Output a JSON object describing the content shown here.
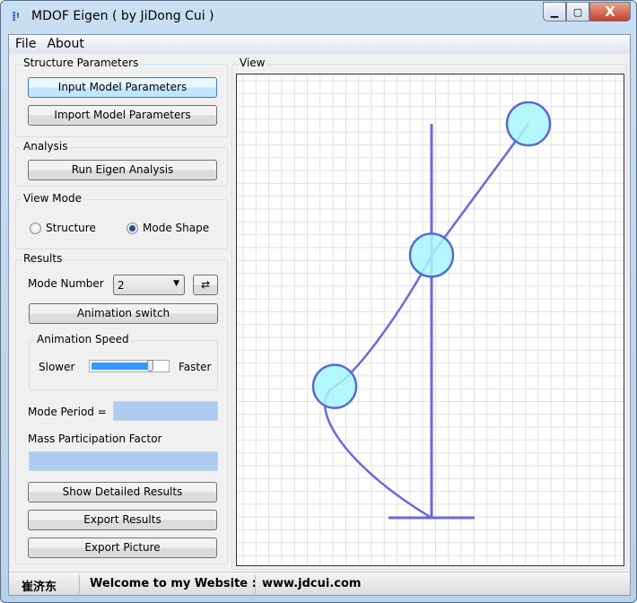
{
  "window": {
    "title": "MDOF Eigen ( by JiDong Cui )",
    "icon": "app-icon",
    "controls": [
      "minimize-icon",
      "maximize-icon",
      "close-icon"
    ]
  },
  "menu": [
    "File",
    "About"
  ],
  "structure": {
    "label": "Structure Parameters",
    "input_btn": "Input Model Parameters",
    "import_btn": "Import Model Parameters"
  },
  "analysis": {
    "label": "Analysis",
    "run_btn": "Run Eigen Analysis"
  },
  "view_mode": {
    "label": "View Mode",
    "options": [
      "Structure",
      "Mode Shape"
    ],
    "selected": "Mode Shape"
  },
  "results": {
    "label": "Results",
    "mode_number_label": "Mode Number",
    "mode_number": "2",
    "refresh_icon": "refresh-icon",
    "animation_btn": "Animation switch",
    "speed": {
      "label": "Animation Speed",
      "slower": "Slower",
      "faster": "Faster",
      "value": 8,
      "max": 10
    },
    "period_label": "Mode Period =",
    "period_value": "",
    "mpf_label": "Mass Participation Factor",
    "mpf_value": "",
    "detail_btn": "Show Detailed Results",
    "export_btn": "Export Results",
    "picture_btn": "Export Picture"
  },
  "view": {
    "label": "View",
    "mode_shape": [
      0,
      -1,
      0,
      1
    ],
    "colors": {
      "line": "#6a6ad8",
      "mass": "#a6f7fb",
      "mass_border": "#5a6ad0",
      "grid": "#e2e2e2"
    }
  },
  "status": {
    "name": "崔济东",
    "welcome": "Welcome to my Website :",
    "url": "www.jdcui.com"
  }
}
